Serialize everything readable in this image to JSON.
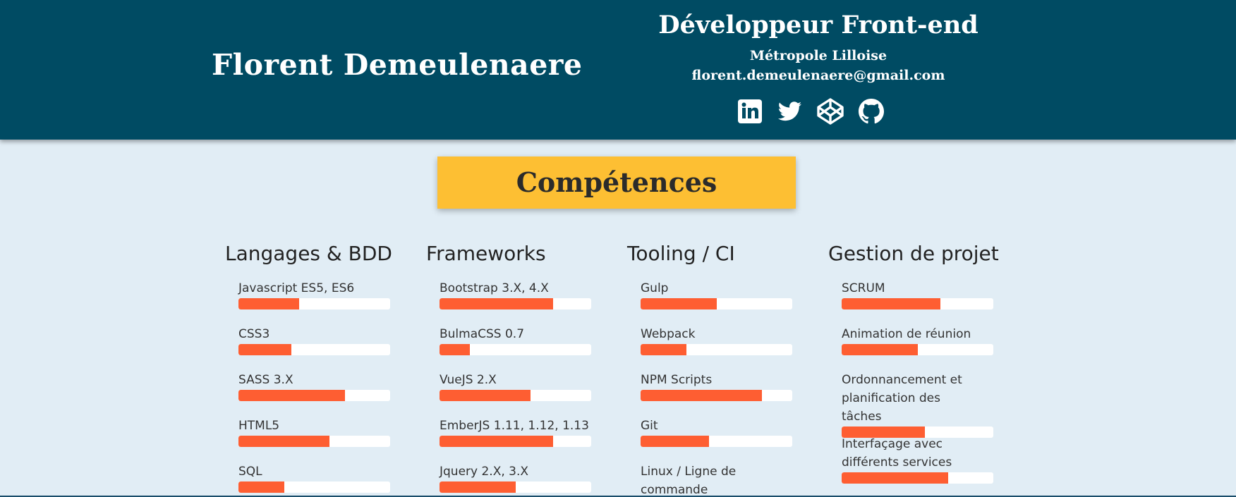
{
  "header": {
    "name": "Florent Demeulenaere",
    "job_title": "Développeur Front-end",
    "location": "Métropole Lilloise",
    "email": "florent.demeulenaere@gmail.com",
    "social_icons": [
      "linkedin-icon",
      "twitter-icon",
      "codepen-icon",
      "github-icon"
    ]
  },
  "section": {
    "title": "Compétences"
  },
  "colors": {
    "header_bg": "#004b63",
    "title_bg": "#fdbf33",
    "bar_fill": "#fe5e32",
    "page_bg": "#e1edf5"
  },
  "columns": [
    {
      "title": "Langages & BDD",
      "skills": [
        {
          "label": "Javascript ES5, ES6",
          "level": 0.4
        },
        {
          "label": "CSS3",
          "level": 0.35
        },
        {
          "label": "SASS 3.X",
          "level": 0.7
        },
        {
          "label": "HTML5",
          "level": 0.6
        },
        {
          "label": "SQL",
          "level": 0.3
        }
      ]
    },
    {
      "title": "Frameworks",
      "skills": [
        {
          "label": "Bootstrap 3.X, 4.X",
          "level": 0.75
        },
        {
          "label": "BulmaCSS 0.7",
          "level": 0.2
        },
        {
          "label": "VueJS 2.X",
          "level": 0.6
        },
        {
          "label": "EmberJS 1.11, 1.12, 1.13",
          "level": 0.75
        },
        {
          "label": "Jquery 2.X, 3.X",
          "level": 0.5
        }
      ]
    },
    {
      "title": "Tooling / CI",
      "skills": [
        {
          "label": "Gulp",
          "level": 0.5
        },
        {
          "label": "Webpack",
          "level": 0.3
        },
        {
          "label": "NPM Scripts",
          "level": 0.8
        },
        {
          "label": "Git",
          "level": 0.45
        },
        {
          "label": "Linux / Ligne de commande",
          "level": null
        }
      ]
    },
    {
      "title": "Gestion de projet",
      "skills": [
        {
          "label": "SCRUM",
          "level": 0.65
        },
        {
          "label": "Animation de réunion",
          "level": 0.5
        },
        {
          "label": "Ordonnancement et planification des tâches",
          "level": 0.55
        },
        {
          "label": "Interfaçage avec différents services",
          "level": 0.7
        }
      ]
    }
  ]
}
